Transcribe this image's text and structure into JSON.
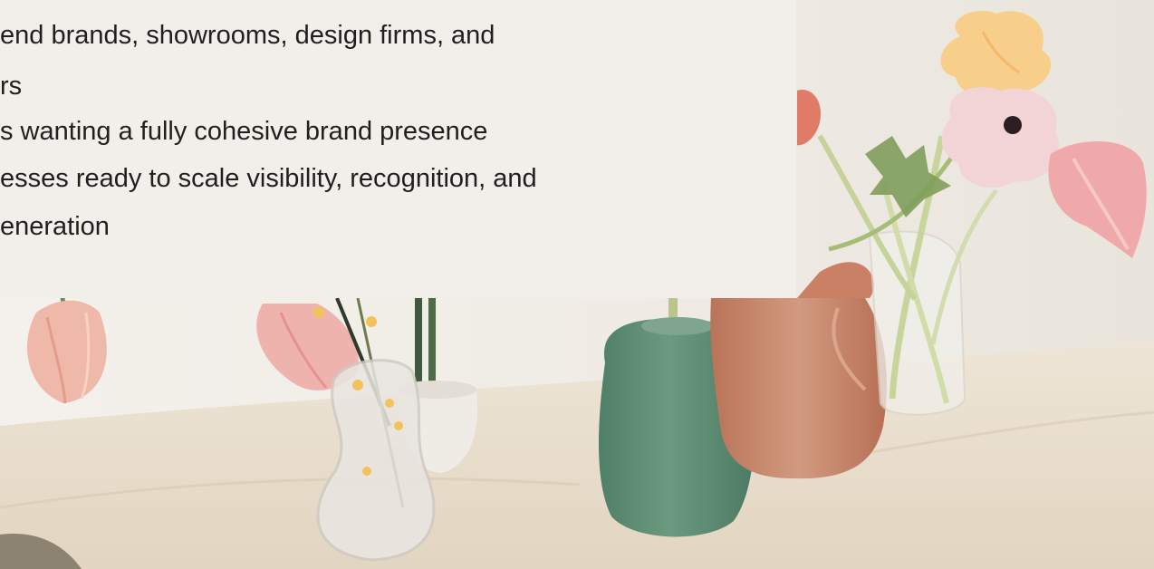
{
  "text_panel": {
    "lines": [
      "end brands, showrooms, design firms, and",
      "rs",
      "s wanting a fully cohesive brand presence",
      "esses ready to scale visibility, recognition, and",
      "eneration"
    ]
  },
  "background_photo": {
    "subject": "flowers-in-vases-on-table",
    "colors": {
      "wall": "#f2efe9",
      "tablecloth": "#e9dfcf",
      "green_vase": "#5e8f74",
      "terracotta_vase": "#c98a6f",
      "pink_petals": "#f0b7b5",
      "yellow_petals": "#f6cf88"
    }
  }
}
